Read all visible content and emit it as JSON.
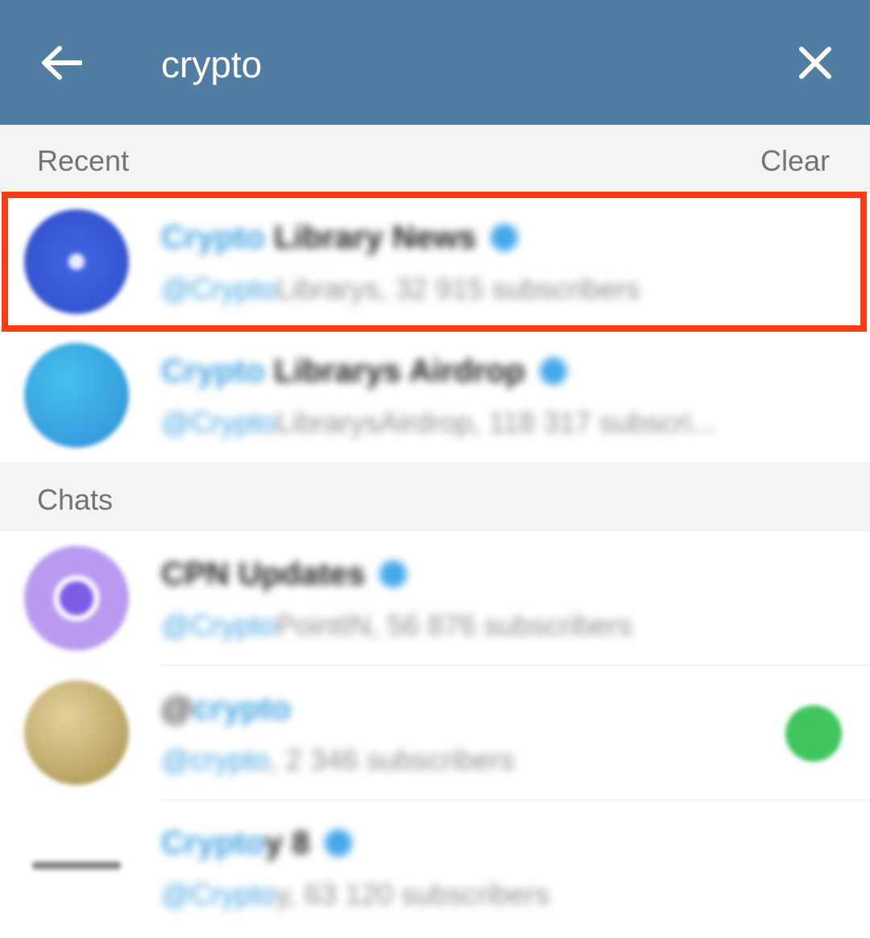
{
  "search": {
    "value": "crypto",
    "back_icon": "arrow-left-icon",
    "close_icon": "close-icon"
  },
  "recent": {
    "header": "Recent",
    "clear_label": "Clear",
    "items": [
      {
        "title_hl": "Crypto",
        "title_rest": " Library News",
        "sub_hl": "@Crypto",
        "sub_rest": "Librarys, 32 915 subscribers",
        "verified": true,
        "avatar_colors": [
          "#3f63e0",
          "#2f4ec8"
        ]
      },
      {
        "title_hl": "Crypto",
        "title_rest": " Librarys Airdrop",
        "sub_hl": "@Crypto",
        "sub_rest": "LibrarysAirdrop, 118 317 subscri...",
        "verified": true,
        "avatar_colors": [
          "#39b3e8",
          "#2f8fd6"
        ]
      }
    ]
  },
  "chats": {
    "header": "Chats",
    "items": [
      {
        "title_hl": "",
        "title_rest": "CPN Updates",
        "sub_hl": "@Crypto",
        "sub_rest": "PointIN, 56 876 subscribers",
        "verified": true,
        "avatar_colors": [
          "#b99af0",
          "#7d5ce6"
        ]
      },
      {
        "title_hl": "crypto",
        "title_rest": "@",
        "sub_hl": "@crypto",
        "sub_rest": ", 2 346 subscribers",
        "verified": false,
        "avatar_colors": [
          "#d8c487",
          "#a8904e"
        ]
      },
      {
        "title_hl": "Crypto",
        "title_rest": "y 8",
        "sub_hl": "@Crypto",
        "sub_rest": "y, 63 120 subscribers",
        "verified": true,
        "avatar_colors": [
          "#ffffff",
          "#ffffff"
        ]
      }
    ]
  },
  "colors": {
    "topbar": "#517da2",
    "highlight_border": "#ff3b14",
    "link_blue": "#3ea1e0",
    "unread_badge": "#41c55e"
  }
}
